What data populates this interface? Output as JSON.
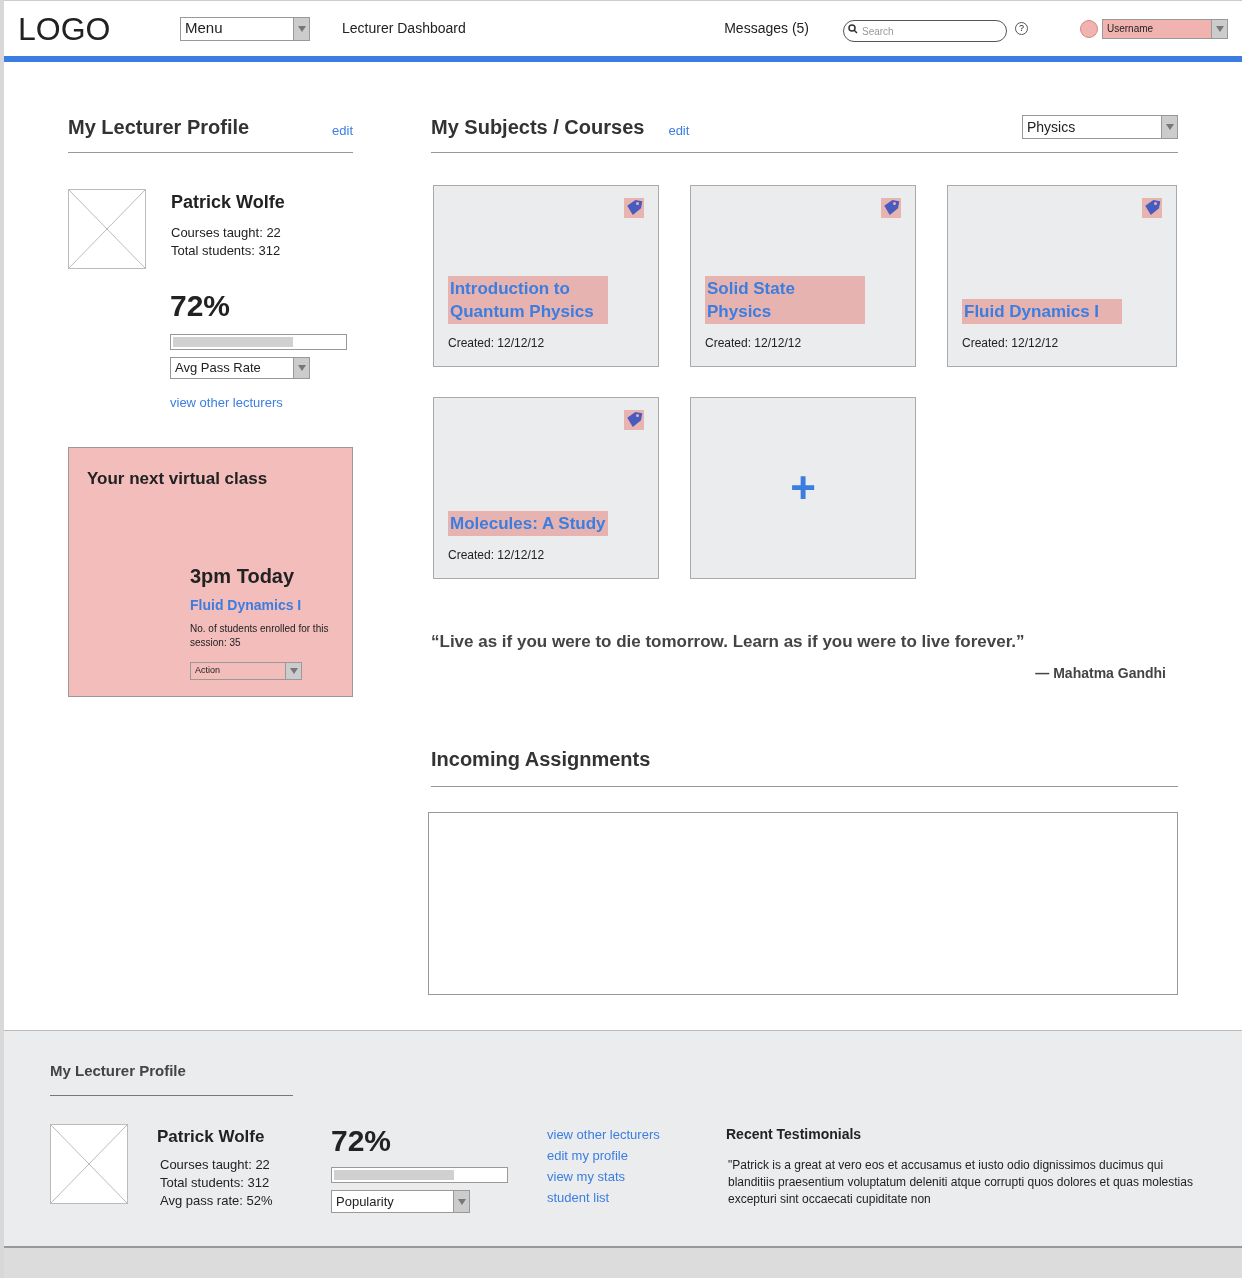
{
  "header": {
    "logo": "LOGO",
    "menu": "Menu",
    "title": "Lecturer Dashboard",
    "messages": "Messages (5)",
    "search": {
      "placeholder": "Search"
    },
    "help": "?",
    "username": "Username"
  },
  "profile": {
    "heading": "My Lecturer Profile",
    "edit": "edit",
    "name": "Patrick Wolfe",
    "stats": [
      "Courses taught: 22",
      "Total students: 312"
    ],
    "percent": "72%",
    "level": 0.7,
    "metric": "Avg Pass Rate",
    "link": "view other lecturers"
  },
  "next_class": {
    "heading": "Your next virtual class",
    "time": "3pm Today",
    "course": "Fluid Dynamics I",
    "note": "No. of students enrolled for this session: 35",
    "action": "Action"
  },
  "courses": {
    "heading": "My Subjects / Courses",
    "edit": "edit",
    "filter": "Physics",
    "add": "+",
    "items": [
      {
        "title": "Introduction to Quantum Physics",
        "created": "Created: 12/12/12"
      },
      {
        "title": "Solid State Physics",
        "created": "Created: 12/12/12"
      },
      {
        "title": "Fluid Dynamics I",
        "created": "Created: 12/12/12"
      },
      {
        "title": "Molecules: A Study",
        "created": "Created: 12/12/12"
      }
    ]
  },
  "quote": {
    "text": "“Live as if you were to die tomorrow. Learn as if you were to live forever.”",
    "author": "— Mahatma Gandhi"
  },
  "assignments": {
    "heading": "Incoming Assignments"
  },
  "footer": {
    "heading": "My Lecturer Profile",
    "name": "Patrick Wolfe",
    "stats": [
      "Courses taught: 22",
      "Total students: 312",
      "Avg pass rate: 52%"
    ],
    "percent": "72%",
    "level": 0.7,
    "metric": "Popularity",
    "links": [
      "view other lecturers",
      "edit my profile",
      "view my stats",
      "student list"
    ],
    "testimonials_heading": "Recent Testimonials",
    "testimonial": "\"Patrick is a great at vero eos et accusamus et iusto odio dignissimos ducimus qui blanditiis praesentium voluptatum deleniti atque corrupti quos dolores et quas molestias excepturi sint occaecati cupiditate non"
  }
}
